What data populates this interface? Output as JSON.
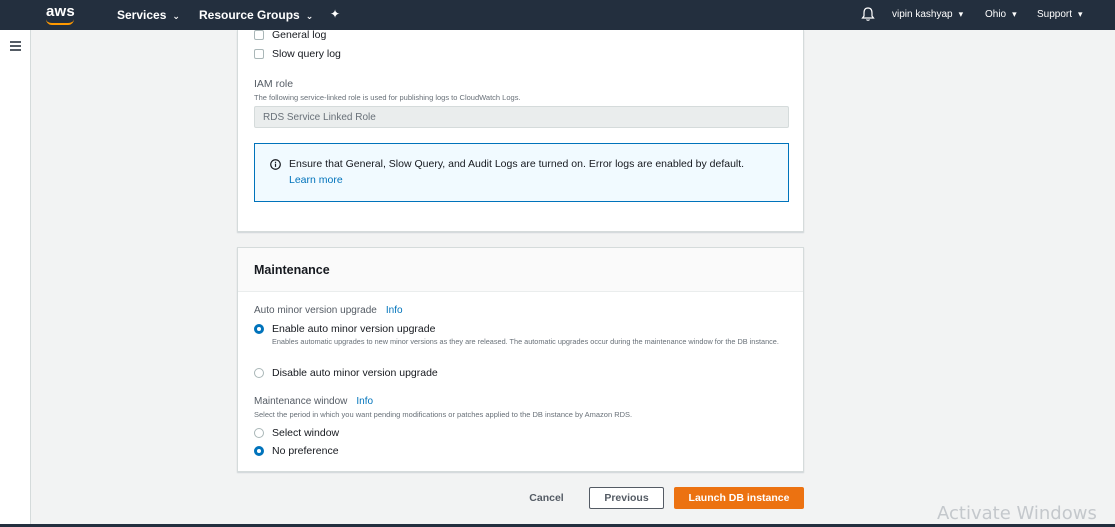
{
  "topnav": {
    "logo": "aws",
    "services": "Services",
    "resource_groups": "Resource Groups",
    "user": "vipin kashyap",
    "region": "Ohio",
    "support": "Support"
  },
  "logs": {
    "general_log": "General log",
    "slow_query_log": "Slow query log"
  },
  "iam": {
    "label": "IAM role",
    "description": "The following service-linked role is used for publishing logs to CloudWatch Logs.",
    "value": "RDS Service Linked Role"
  },
  "alert": {
    "text": "Ensure that General, Slow Query, and Audit Logs are turned on. Error logs are enabled by default.",
    "link": "Learn more"
  },
  "maintenance": {
    "title": "Maintenance",
    "auto_minor_label": "Auto minor version upgrade",
    "info": "Info",
    "enable_label": "Enable auto minor version upgrade",
    "enable_desc": "Enables automatic upgrades to new minor versions as they are released. The automatic upgrades occur during the maintenance window for the DB instance.",
    "disable_label": "Disable auto minor version upgrade",
    "window_label": "Maintenance window",
    "window_desc": "Select the period in which you want pending modifications or patches applied to the DB instance by Amazon RDS.",
    "select_window": "Select window",
    "no_preference": "No preference"
  },
  "actions": {
    "cancel": "Cancel",
    "previous": "Previous",
    "launch": "Launch DB instance"
  },
  "watermark": "Activate Windows",
  "colors": {
    "nav_bg": "#232f3e",
    "accent": "#ec7211",
    "link": "#0073bb"
  }
}
